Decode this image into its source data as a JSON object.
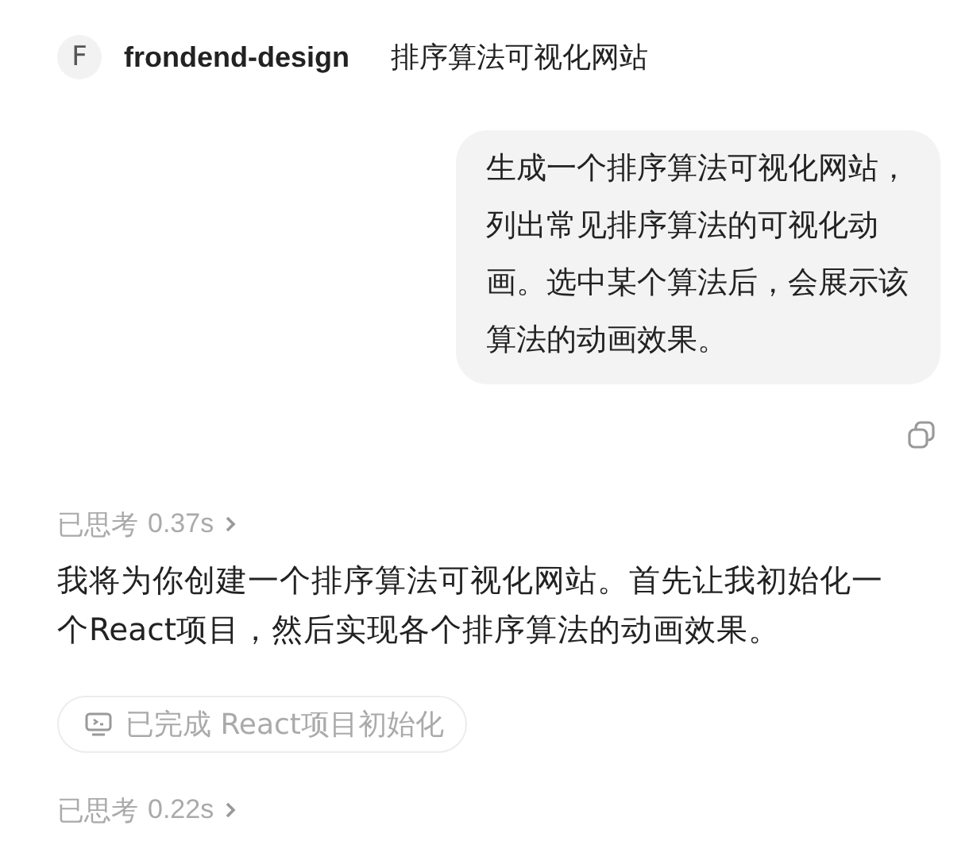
{
  "header": {
    "avatar": "F",
    "agent": "frondend-design",
    "title": "排序算法可视化网站"
  },
  "user_message": {
    "text": "生成一个排序算法可视化网站，列出常见排序算法的可视化动画。选中某个算法后，会展示该算法的动画效果。"
  },
  "messages": [
    {
      "kind": "thought",
      "label": "已思考",
      "duration": "0.37s"
    },
    {
      "kind": "text",
      "text": "我将为你创建一个排序算法可视化网站。首先让我初始化一个React项目，然后实现各个排序算法的动画效果。"
    },
    {
      "kind": "task",
      "text": "已完成 React项目初始化"
    },
    {
      "kind": "thought",
      "label": "已思考",
      "duration": "0.22s"
    }
  ]
}
